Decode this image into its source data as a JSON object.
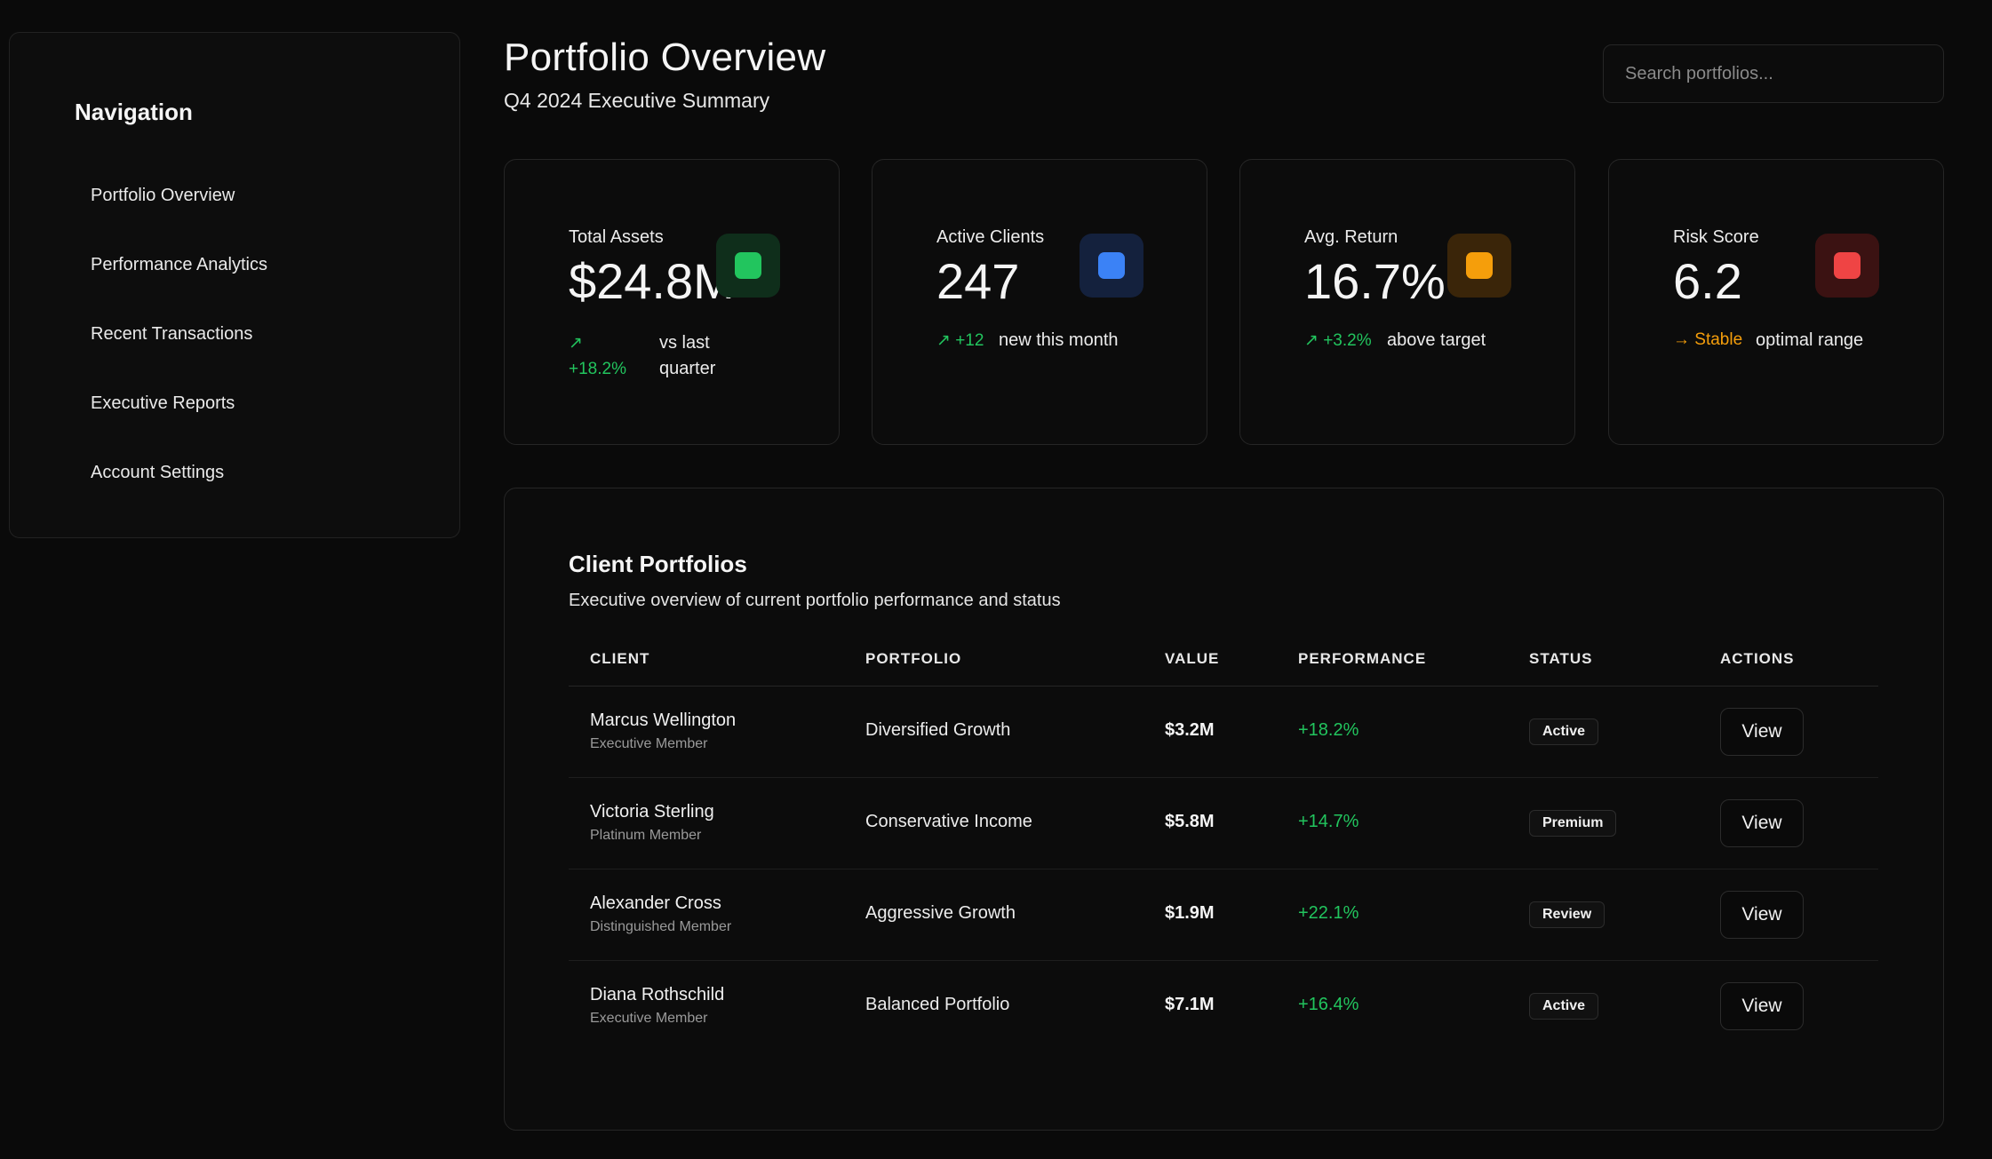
{
  "sidebar": {
    "title": "Navigation",
    "items": [
      {
        "label": "Portfolio Overview"
      },
      {
        "label": "Performance Analytics"
      },
      {
        "label": "Recent Transactions"
      },
      {
        "label": "Executive Reports"
      },
      {
        "label": "Account Settings"
      }
    ]
  },
  "header": {
    "title": "Portfolio Overview",
    "subtitle": "Q4 2024 Executive Summary"
  },
  "search": {
    "placeholder": "Search portfolios..."
  },
  "stats": [
    {
      "label": "Total Assets",
      "value": "$24.8M",
      "change_arrow": "↗",
      "change": "+18.2%",
      "note": "vs last quarter",
      "accent": "#22c55e",
      "icon": "green-square-icon"
    },
    {
      "label": "Active Clients",
      "value": "247",
      "change_arrow": "↗",
      "change": "+12",
      "note": "new this month",
      "accent": "#3b82f6",
      "icon": "blue-square-icon"
    },
    {
      "label": "Avg. Return",
      "value": "16.7%",
      "change_arrow": "↗",
      "change": "+3.2%",
      "note": "above target",
      "accent": "#f59e0b",
      "icon": "orange-square-icon"
    },
    {
      "label": "Risk Score",
      "value": "6.2",
      "change_arrow": "→",
      "change": "Stable",
      "note": "optimal range",
      "accent": "#ef4444",
      "icon": "red-square-icon"
    }
  ],
  "table": {
    "title": "Client Portfolios",
    "subtitle": "Executive overview of current portfolio performance and status",
    "columns": [
      "CLIENT",
      "PORTFOLIO",
      "VALUE",
      "PERFORMANCE",
      "STATUS",
      "ACTIONS"
    ],
    "rows": [
      {
        "name": "Marcus Wellington",
        "tier": "Executive Member",
        "portfolio": "Diversified Growth",
        "value": "$3.2M",
        "performance": "+18.2%",
        "status": "Active",
        "action": "View"
      },
      {
        "name": "Victoria Sterling",
        "tier": "Platinum Member",
        "portfolio": "Conservative Income",
        "value": "$5.8M",
        "performance": "+14.7%",
        "status": "Premium",
        "action": "View"
      },
      {
        "name": "Alexander Cross",
        "tier": "Distinguished Member",
        "portfolio": "Aggressive Growth",
        "value": "$1.9M",
        "performance": "+22.1%",
        "status": "Review",
        "action": "View"
      },
      {
        "name": "Diana Rothschild",
        "tier": "Executive Member",
        "portfolio": "Balanced Portfolio",
        "value": "$7.1M",
        "performance": "+16.4%",
        "status": "Active",
        "action": "View"
      }
    ]
  },
  "colors": {
    "background": "#0a0a0a",
    "positive": "#22c55e",
    "neutral_warning": "#f59e0b"
  }
}
